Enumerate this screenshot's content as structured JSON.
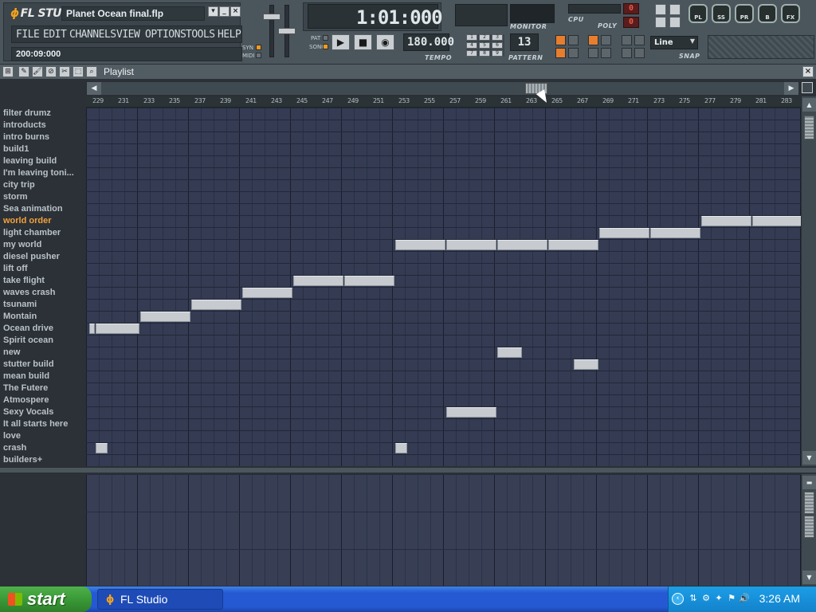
{
  "app": {
    "logo_text": "FL STUDIO",
    "filename": "Planet Ocean final.flp",
    "menu": [
      "FILE",
      "EDIT",
      "CHANNELS",
      "VIEW",
      "OPTIONS",
      "TOOLS",
      "HELP"
    ],
    "song_position": "200:09:000",
    "syn_label": "SYN",
    "midi_label": "MIDI",
    "pat_label": "PAT",
    "song_label": "SONG"
  },
  "transport": {
    "time_display": "1:01:000",
    "tempo_value": "180.000",
    "tempo_label": "TEMPO",
    "pattern_value": "13",
    "pattern_label": "PATTERN",
    "monitor_label": "MONITOR",
    "cpu_label": "CPU",
    "cpu_value": "0",
    "poly_label": "POLY",
    "poly_value": "0"
  },
  "snap": {
    "value": "Line",
    "label": "SNAP"
  },
  "view_buttons": [
    "PL",
    "SS",
    "PR",
    "B",
    "FX"
  ],
  "playlist": {
    "title": "Playlist",
    "ruler_start": 229,
    "ruler_step": 2,
    "ruler_labels": [
      "229",
      "231",
      "233",
      "235",
      "237",
      "239",
      "241",
      "243",
      "245",
      "247",
      "249",
      "251",
      "253",
      "255",
      "257",
      "259",
      "261",
      "263",
      "265",
      "267",
      "269",
      "271",
      "273",
      "275",
      "277",
      "279",
      "281",
      "283"
    ],
    "tracks": [
      "filter drumz",
      "introducts",
      "intro burns",
      "build1",
      "leaving build",
      "I'm leaving toni...",
      "city trip",
      "storm",
      " Sea animation",
      "world order",
      "light chamber",
      "my world",
      "diesel pusher",
      "lift off",
      "take flight",
      "waves crash",
      "tsunami",
      "Montain",
      "Ocean drive",
      "Spirit ocean",
      "new",
      "stutter build",
      "mean build",
      "The Futere",
      "Atmospere",
      "Sexy Vocals",
      "It all starts here",
      "love",
      "crash",
      "builders+"
    ],
    "highlighted_track": "world order",
    "clips": [
      {
        "track": 9,
        "start": 277,
        "end": 281
      },
      {
        "track": 9,
        "start": 281,
        "end": 285
      },
      {
        "track": 10,
        "start": 269,
        "end": 273
      },
      {
        "track": 10,
        "start": 273,
        "end": 277
      },
      {
        "track": 11,
        "start": 253,
        "end": 257
      },
      {
        "track": 11,
        "start": 257,
        "end": 261
      },
      {
        "track": 11,
        "start": 261,
        "end": 265
      },
      {
        "track": 11,
        "start": 265,
        "end": 269
      },
      {
        "track": 14,
        "start": 245,
        "end": 249
      },
      {
        "track": 14,
        "start": 249,
        "end": 253
      },
      {
        "track": 15,
        "start": 241,
        "end": 245
      },
      {
        "track": 16,
        "start": 237,
        "end": 241
      },
      {
        "track": 17,
        "start": 233,
        "end": 237
      },
      {
        "track": 18,
        "start": 229,
        "end": 229.5
      },
      {
        "track": 18,
        "start": 229.5,
        "end": 233
      },
      {
        "track": 20,
        "start": 261,
        "end": 263
      },
      {
        "track": 21,
        "start": 267,
        "end": 269
      },
      {
        "track": 25,
        "start": 257,
        "end": 261
      },
      {
        "track": 28,
        "start": 229.5,
        "end": 230.5
      },
      {
        "track": 28,
        "start": 253,
        "end": 254
      }
    ]
  },
  "taskbar": {
    "start_label": "start",
    "task_label": "FL Studio",
    "clock": "3:26 AM"
  }
}
